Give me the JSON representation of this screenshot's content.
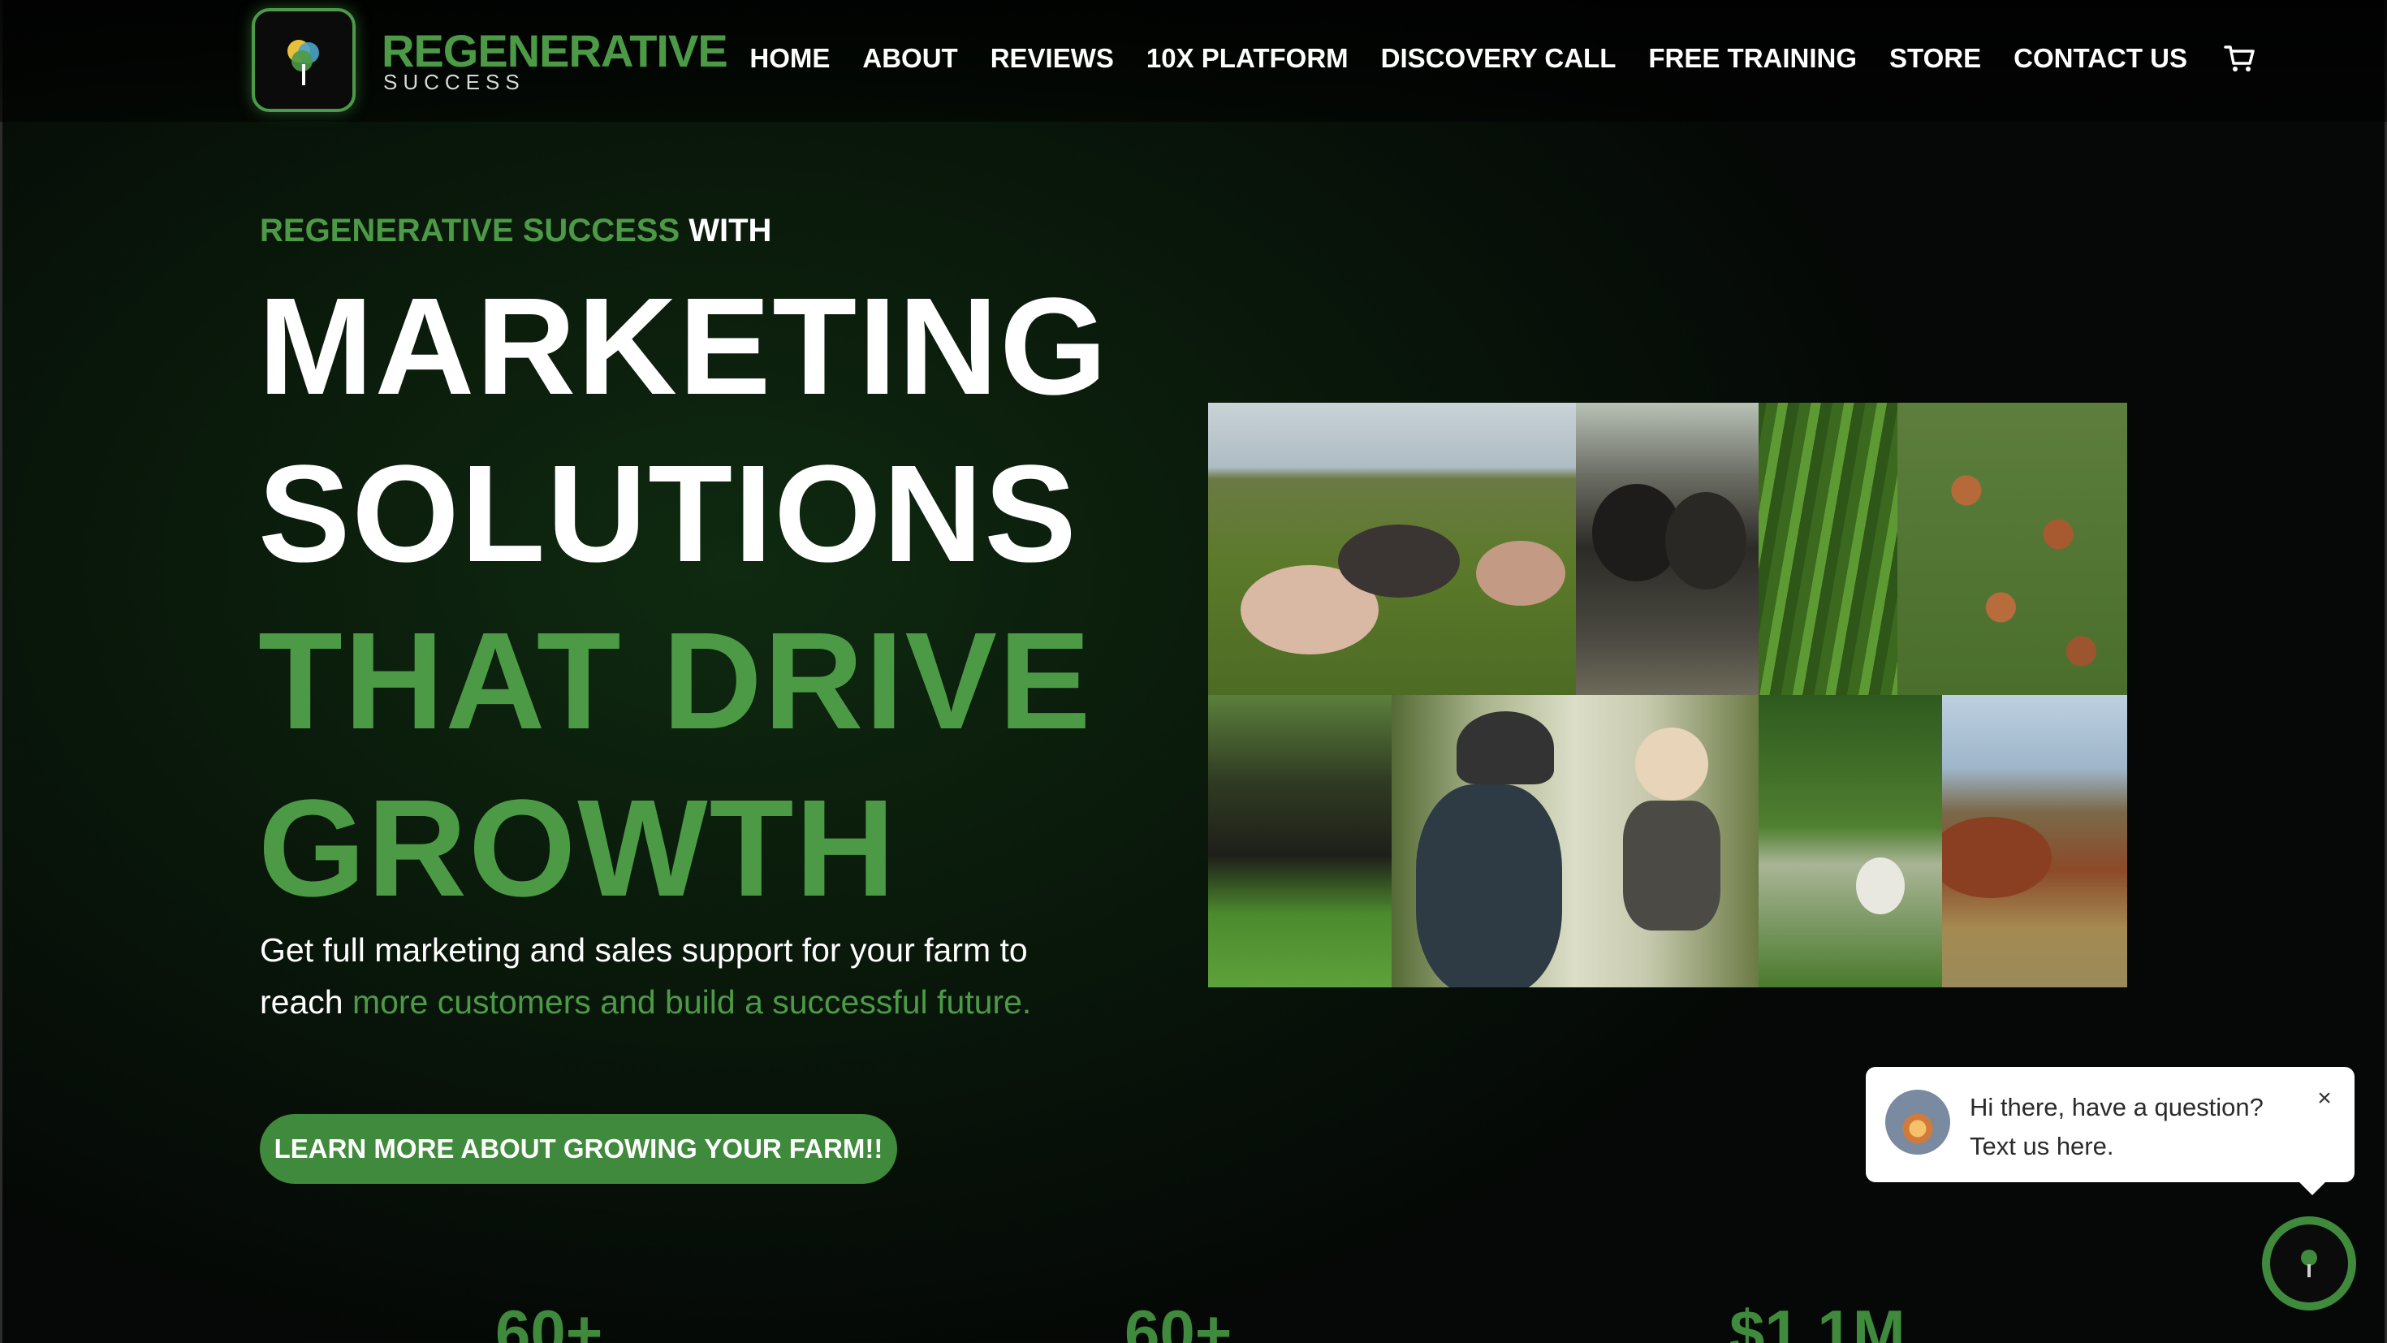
{
  "brand": {
    "title": "REGENERATIVE",
    "subtitle": "SUCCESS"
  },
  "nav": {
    "items": [
      "HOME",
      "ABOUT",
      "REVIEWS",
      "10X PLATFORM",
      "DISCOVERY CALL",
      "FREE TRAINING",
      "STORE",
      "CONTACT US"
    ],
    "cart_icon": "cart-icon"
  },
  "hero": {
    "eyebrow_green": "REGENERATIVE SUCCESS",
    "eyebrow_white": " WITH",
    "line1": "MARKETING",
    "line2": "SOLUTIONS",
    "line3": "THAT DRIVE",
    "line4": "GROWTH",
    "desc_white": "Get full marketing and sales support for your farm to reach ",
    "desc_green": "more customers and build a successful future.",
    "cta_label": "LEARN MORE ABOUT GROWING YOUR FARM!!"
  },
  "chat": {
    "line1": "Hi there, have a question?",
    "line2": "Text us here.",
    "close_glyph": "×"
  },
  "stats": [
    "60+",
    "60+",
    "$1.1M"
  ],
  "colors": {
    "brand_green": "#4c9a46",
    "button_green": "#3f8a3c",
    "background": "#0a1a0b"
  }
}
